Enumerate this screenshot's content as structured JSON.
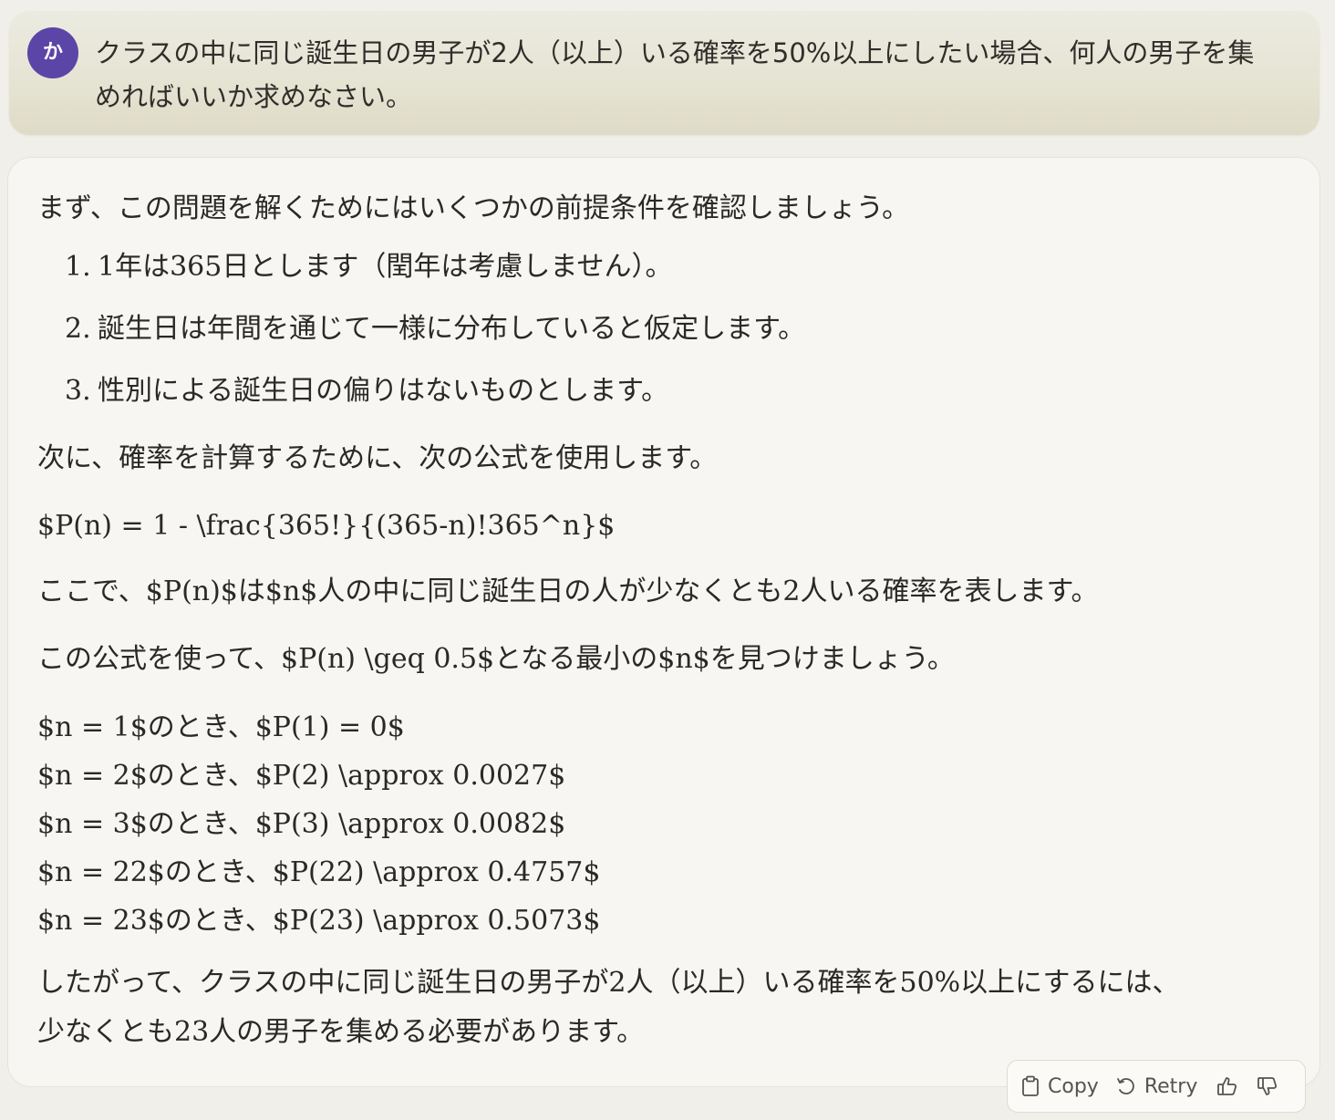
{
  "user_message": {
    "avatar_initial": "か",
    "text": "クラスの中に同じ誕生日の男子が2人（以上）いる確率を50%以上にしたい場合、何人の男子を集めればいいか求めなさい。"
  },
  "assistant_message": {
    "intro": "まず、この問題を解くためにはいくつかの前提条件を確認しましょう。",
    "assumptions": [
      {
        "num": "1.",
        "text": "1年は365日とします（閏年は考慮しません）。"
      },
      {
        "num": "2.",
        "text": "誕生日は年間を通じて一様に分布していると仮定します。"
      },
      {
        "num": "3.",
        "text": "性別による誕生日の偏りはないものとします。"
      }
    ],
    "formula_intro": "次に、確率を計算するために、次の公式を使用します。",
    "formula": "$P(n) = 1 - \\frac{365!}{(365-n)!365^n}$",
    "formula_explain": "ここで、$P(n)$は$n$人の中に同じ誕生日の人が少なくとも2人いる確率を表します。",
    "use_formula": "この公式を使って、$P(n) \\geq 0.5$となる最小の$n$を見つけましょう。",
    "calculations": [
      "$n = 1$のとき、$P(1) = 0$",
      "$n = 2$のとき、$P(2) \\approx 0.0027$",
      "$n = 3$のとき、$P(3) \\approx 0.0082$",
      "$n = 22$のとき、$P(22) \\approx 0.4757$",
      "$n = 23$のとき、$P(23) \\approx 0.5073$"
    ],
    "conclusion_line1": "したがって、クラスの中に同じ誕生日の男子が2人（以上）いる確率を50%以上にするには、",
    "conclusion_line2": "少なくとも23人の男子を集める必要があります。"
  },
  "actions": {
    "copy_label": "Copy",
    "retry_label": "Retry",
    "copy_icon": "clipboard-icon",
    "retry_icon": "retry-icon",
    "thumbs_up_icon": "thumbs-up-icon",
    "thumbs_down_icon": "thumbs-down-icon"
  },
  "colors": {
    "avatar_bg": "#5b45a6",
    "page_bg": "#f1efe9",
    "user_bubble": "#e5e3d2",
    "assistant_bubble": "#f7f6f2"
  }
}
